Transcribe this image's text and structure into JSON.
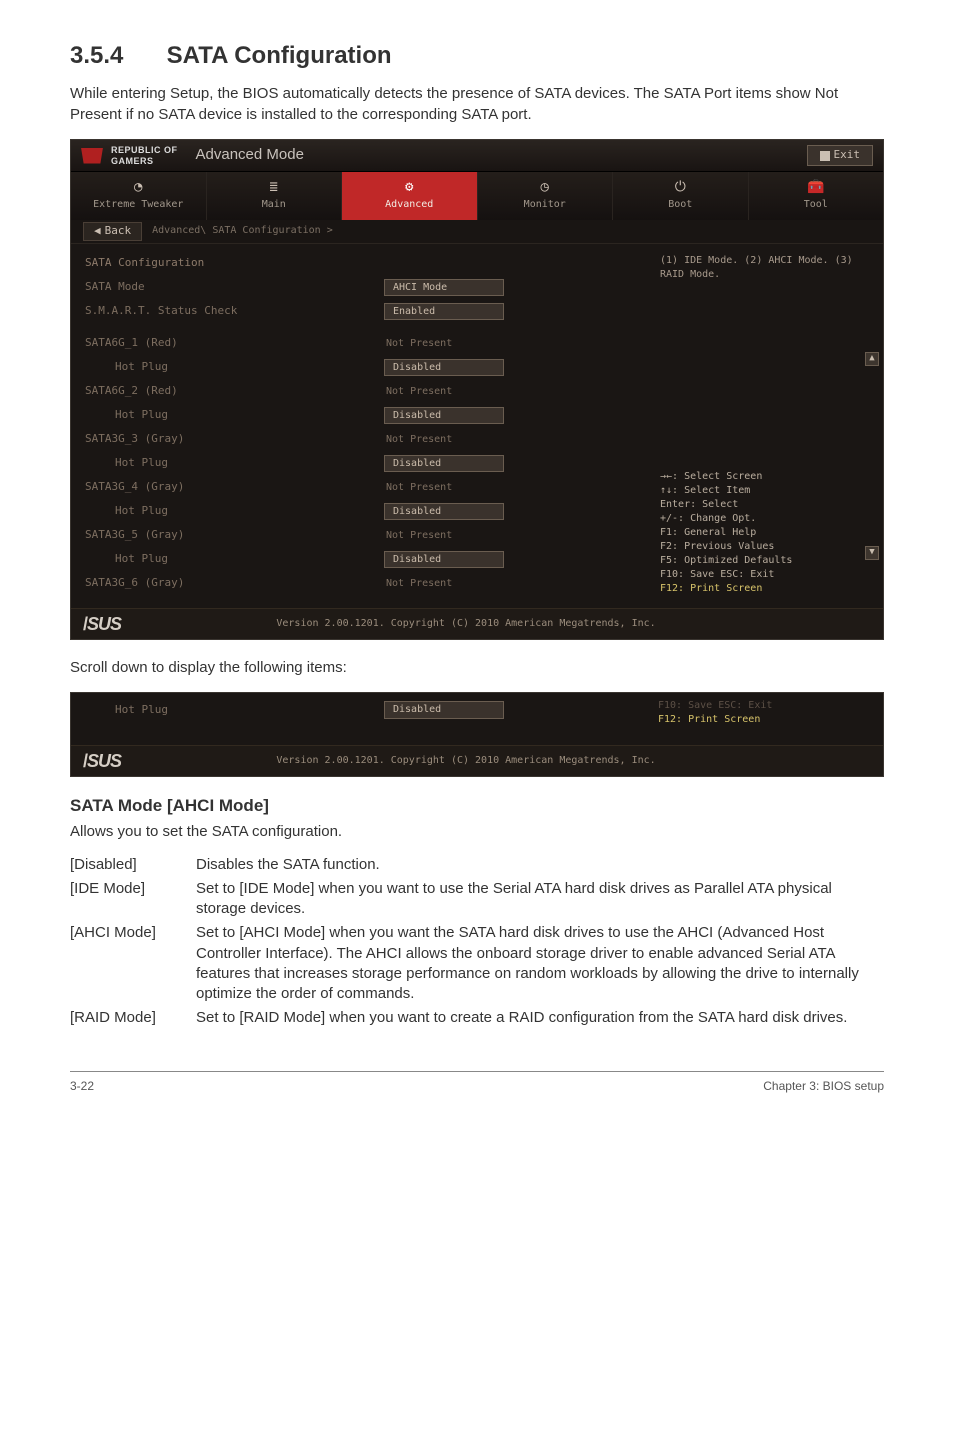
{
  "section": {
    "number": "3.5.4",
    "title": "SATA Configuration"
  },
  "intro": "While entering Setup, the BIOS automatically detects the presence of SATA devices. The SATA Port items show Not Present if no SATA device is installed to the corresponding SATA port.",
  "intro_bold": "Not Present",
  "bios": {
    "brand_l1": "REPUBLIC OF",
    "brand_l2": "GAMERS",
    "mode": "Advanced Mode",
    "exit": "Exit",
    "tabs": {
      "extreme": "Extreme Tweaker",
      "main": "Main",
      "advanced": "Advanced",
      "monitor": "Monitor",
      "boot": "Boot",
      "tool": "Tool"
    },
    "back": "Back",
    "crumb": "Advanced\\ SATA Configuration >",
    "rows": {
      "header": "SATA Configuration",
      "sata_mode_l": "SATA Mode",
      "sata_mode_v": "AHCI Mode",
      "smart_l": "S.M.A.R.T. Status Check",
      "smart_v": "Enabled",
      "p1_l": "SATA6G_1 (Red)",
      "p1_v": "Not Present",
      "p1h_l": "Hot Plug",
      "p1h_v": "Disabled",
      "p2_l": "SATA6G_2 (Red)",
      "p2_v": "Not Present",
      "p2h_l": "Hot Plug",
      "p2h_v": "Disabled",
      "p3_l": "SATA3G_3 (Gray)",
      "p3_v": "Not Present",
      "p3h_l": "Hot Plug",
      "p3h_v": "Disabled",
      "p4_l": "SATA3G_4 (Gray)",
      "p4_v": "Not Present",
      "p4h_l": "Hot Plug",
      "p4h_v": "Disabled",
      "p5_l": "SATA3G_5 (Gray)",
      "p5_v": "Not Present",
      "p5h_l": "Hot Plug",
      "p5h_v": "Disabled",
      "p6_l": "SATA3G_6 (Gray)",
      "p6_v": "Not Present"
    },
    "help_top": "(1) IDE Mode. (2) AHCI Mode. (3) RAID Mode.",
    "help_keys": {
      "a": "→←: Select Screen",
      "b": "↑↓: Select Item",
      "c": "Enter: Select",
      "d": "+/-: Change Opt.",
      "e": "F1: General Help",
      "f": "F2: Previous Values",
      "g": "F5: Optimized Defaults",
      "h": "F10: Save  ESC: Exit",
      "i": "F12: Print Screen"
    },
    "footer_copy": "Version 2.00.1201. Copyright (C) 2010 American Megatrends, Inc."
  },
  "scroll_note": "Scroll down to display the following items:",
  "bios_small": {
    "row_l": "Hot Plug",
    "row_v": "Disabled",
    "help_h": "F10: Save  ESC: Exit",
    "help_i": "F12: Print Screen",
    "footer_copy": "Version 2.00.1201. Copyright (C) 2010 American Megatrends, Inc."
  },
  "option_block": {
    "heading": "SATA Mode [AHCI Mode]",
    "intro": "Allows you to set the SATA configuration.",
    "opts": {
      "disabled_k": "[Disabled]",
      "disabled_v": "Disables the SATA function.",
      "ide_k": "[IDE Mode]",
      "ide_v": "Set to [IDE Mode] when you want to use the Serial ATA hard disk drives as Parallel ATA physical storage devices.",
      "ahci_k": "[AHCI Mode]",
      "ahci_v": "Set to [AHCI Mode] when you want the SATA hard disk drives to use the AHCI (Advanced Host Controller Interface). The AHCI allows the onboard storage driver to enable advanced Serial ATA features that increases storage performance on random workloads by allowing the drive to internally optimize the order of commands.",
      "raid_k": "[RAID Mode]",
      "raid_v": "Set to [RAID Mode] when you want to create a RAID configuration from the SATA hard disk drives."
    }
  },
  "footer": {
    "left": "3-22",
    "right": "Chapter 3: BIOS setup"
  }
}
